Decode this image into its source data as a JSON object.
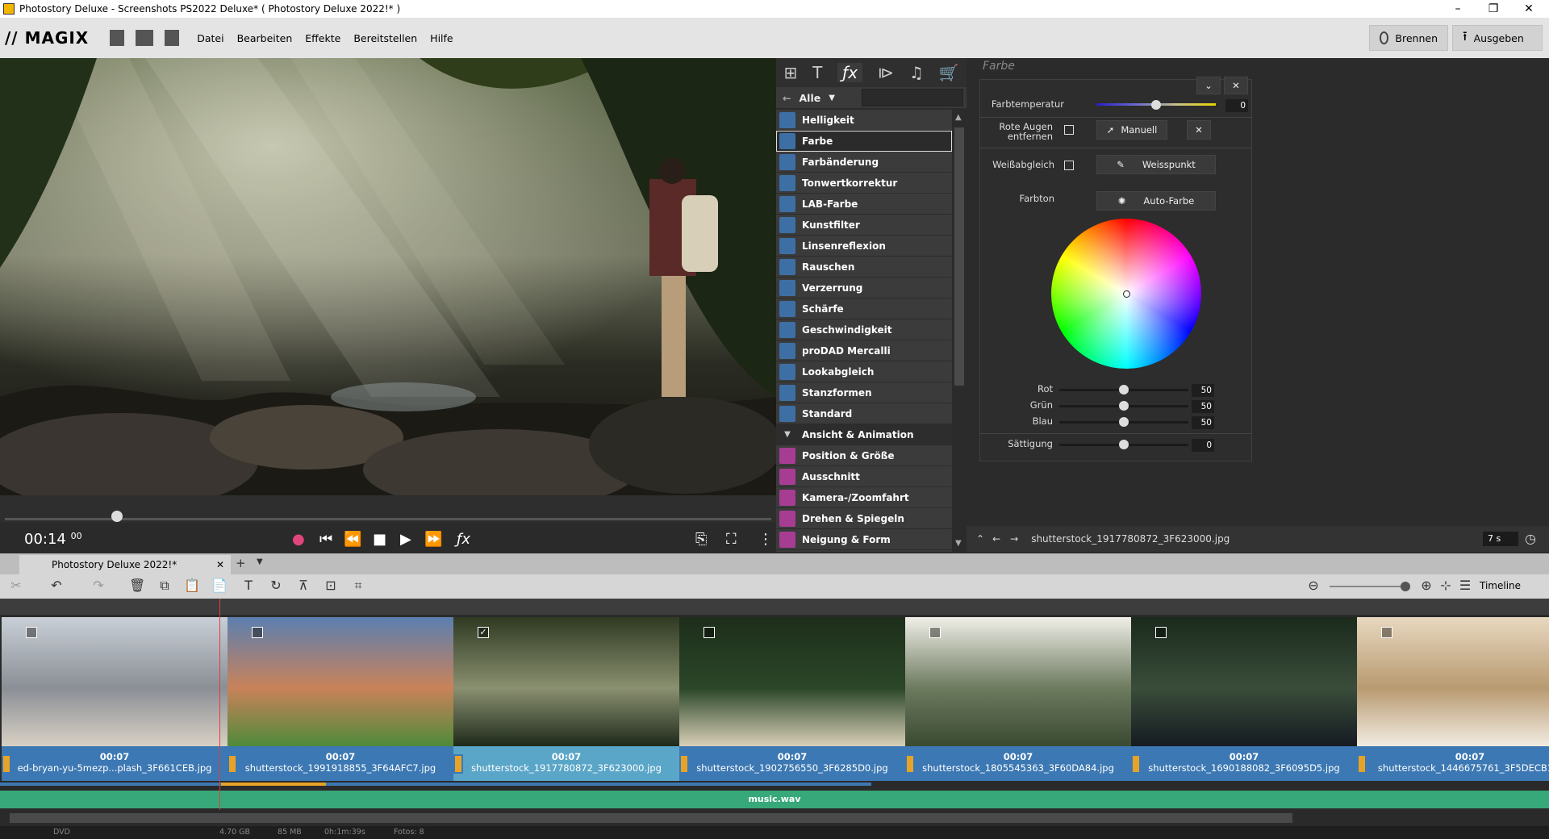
{
  "window": {
    "title": "Photostory Deluxe - Screenshots PS2022 Deluxe* ( Photostory Deluxe 2022!* )",
    "controls": [
      "–",
      "❐",
      "✕"
    ]
  },
  "menubar": {
    "logo": "// MAGIX",
    "items": [
      "Datei",
      "Bearbeiten",
      "Effekte",
      "Bereitstellen",
      "Hilfe"
    ],
    "burn_label": "Brennen",
    "export_label": "Ausgeben"
  },
  "transport": {
    "timecode": "00:14",
    "frames": "00"
  },
  "effects": {
    "filter_label": "Alle",
    "items": [
      {
        "label": "Helligkeit",
        "state": "normal"
      },
      {
        "label": "Farbe",
        "state": "selected"
      },
      {
        "label": "Farbänderung",
        "state": "normal"
      },
      {
        "label": "Tonwertkorrektur",
        "state": "normal"
      },
      {
        "label": "LAB-Farbe",
        "state": "normal"
      },
      {
        "label": "Kunstfilter",
        "state": "normal"
      },
      {
        "label": "Linsenreflexion",
        "state": "normal"
      },
      {
        "label": "Rauschen",
        "state": "normal"
      },
      {
        "label": "Verzerrung",
        "state": "normal"
      },
      {
        "label": "Schärfe",
        "state": "normal"
      },
      {
        "label": "Geschwindigkeit",
        "state": "normal"
      },
      {
        "label": "proDAD Mercalli",
        "state": "normal"
      },
      {
        "label": "Lookabgleich",
        "state": "normal"
      },
      {
        "label": "Stanzformen",
        "state": "normal"
      },
      {
        "label": "Standard",
        "state": "normal"
      },
      {
        "label": "Ansicht & Animation",
        "state": "header"
      },
      {
        "label": "Position & Größe",
        "state": "pink"
      },
      {
        "label": "Ausschnitt",
        "state": "pink"
      },
      {
        "label": "Kamera-/Zoomfahrt",
        "state": "pink"
      },
      {
        "label": "Drehen & Spiegeln",
        "state": "pink"
      },
      {
        "label": "Neigung & Form",
        "state": "pink"
      }
    ]
  },
  "farbe": {
    "title": "Farbe",
    "farbtemperatur_label": "Farbtemperatur",
    "farbtemperatur_value": "0",
    "farbtemperatur_pos": 0.5,
    "rote_augen_label": "Rote Augen entfernen",
    "manuell_label": "Manuell",
    "weissabgleich_label": "Weißabgleich",
    "weisspunkt_label": "Weisspunkt",
    "farbton_label": "Farbton",
    "autofarbe_label": "Auto-Farbe",
    "rgb": [
      {
        "label": "Rot",
        "value": "50"
      },
      {
        "label": "Grün",
        "value": "50"
      },
      {
        "label": "Blau",
        "value": "50"
      }
    ],
    "saettigung_label": "Sättigung",
    "saettigung_value": "0"
  },
  "navstrip": {
    "filename": "shutterstock_1917780872_3F623000.jpg",
    "duration": "7 s"
  },
  "project": {
    "tab_label": "Photostory Deluxe 2022!*"
  },
  "toolbar": {
    "timeline_label": "Timeline"
  },
  "clips": [
    {
      "time": "00:07",
      "name": "ed-bryan-yu-5mezp...plash_3F661CEB.jpg",
      "checked": false,
      "colors": [
        "#c9cfd6",
        "#8a8f96",
        "#d8d0c4"
      ]
    },
    {
      "time": "00:07",
      "name": "shutterstock_1991918855_3F64AFC7.jpg",
      "checked": false,
      "colors": [
        "#5b7fb0",
        "#c9825a",
        "#4f8a3a"
      ]
    },
    {
      "time": "00:07",
      "name": "shutterstock_1917780872_3F623000.jpg",
      "checked": true,
      "colors": [
        "#2f3a22",
        "#8a9070",
        "#1e2a1a"
      ]
    },
    {
      "time": "00:07",
      "name": "shutterstock_1902756550_3F6285D0.jpg",
      "checked": false,
      "colors": [
        "#1d2e1a",
        "#2b4628",
        "#d9d0b8"
      ]
    },
    {
      "time": "00:07",
      "name": "shutterstock_1805545363_3F60DA84.jpg",
      "checked": false,
      "colors": [
        "#f0efe8",
        "#6c7a5e",
        "#3a4a32"
      ]
    },
    {
      "time": "00:07",
      "name": "shutterstock_1690188082_3F6095D5.jpg",
      "checked": false,
      "colors": [
        "#1a2a1c",
        "#3a4d3a",
        "#151b22"
      ]
    },
    {
      "time": "00:07",
      "name": "shutterstock_1446675761_3F5DECB1...",
      "checked": false,
      "colors": [
        "#e8d8c0",
        "#b89a70",
        "#f2ece2"
      ]
    }
  ],
  "audio": {
    "label": "music.wav"
  },
  "statusbar": {
    "format": "DVD",
    "size": "4.70 GB",
    "used": "85 MB",
    "duration": "0h:1m:39s",
    "photos": "Fotos: 8"
  }
}
